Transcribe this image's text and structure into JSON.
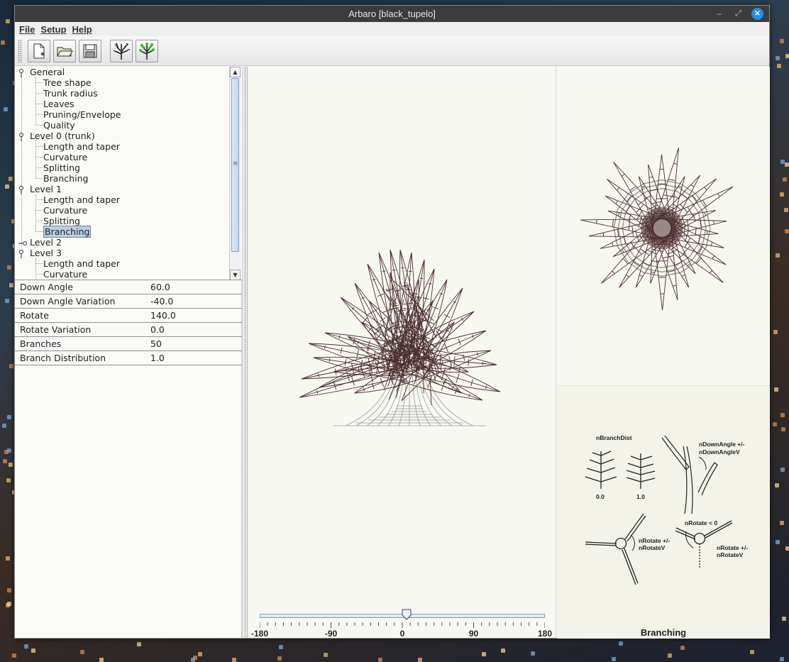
{
  "window": {
    "title": "Arbaro [black_tupelo]"
  },
  "menu": {
    "file": "File",
    "setup": "Setup",
    "help": "Help"
  },
  "toolbar": {
    "buttons": [
      "new-file-icon",
      "open-folder-icon",
      "save-disk-icon",
      "render-tree-icon",
      "render-leafy-tree-icon"
    ]
  },
  "tree": {
    "general": "General",
    "tree_shape": "Tree shape",
    "trunk_radius": "Trunk radius",
    "leaves": "Leaves",
    "pruning": "Pruning/Envelope",
    "quality": "Quality",
    "level0": "Level 0 (trunk)",
    "l0_length": "Length and taper",
    "l0_curvature": "Curvature",
    "l0_splitting": "Splitting",
    "l0_branching": "Branching",
    "level1": "Level 1",
    "l1_length": "Length and taper",
    "l1_curvature": "Curvature",
    "l1_splitting": "Splitting",
    "l1_branching": "Branching",
    "level2": "Level 2",
    "level3": "Level 3",
    "l3_length": "Length and taper",
    "l3_curvature": "Curvature",
    "selected": "Level 1 / Branching"
  },
  "properties": [
    {
      "name": "Down Angle",
      "value": "60.0"
    },
    {
      "name": "Down Angle Variation",
      "value": "-40.0"
    },
    {
      "name": "Rotate",
      "value": "140.0"
    },
    {
      "name": "Rotate Variation",
      "value": "0.0"
    },
    {
      "name": "Branches",
      "value": "50"
    },
    {
      "name": "Branch Distribution",
      "value": "1.0"
    }
  ],
  "rotation_slider": {
    "value": 5,
    "min": -180,
    "max": 180,
    "labels": [
      "-180",
      "-90",
      "0",
      "90",
      "180"
    ]
  },
  "diagram": {
    "caption": "Branching",
    "nBranchDist": "nBranchDist",
    "dist_zero": "0.0",
    "dist_one": "1.0",
    "downangle_line1": "nDownAngle +/-",
    "downangle_line2": "nDownAngleV",
    "rotate_line1": "nRotate +/-",
    "rotate_line2": "nRotateV",
    "rotate_neg": "nRotate < 0",
    "rotate2_line1": "nRotate +/-",
    "rotate2_line2": "nRotateV"
  },
  "colors": {
    "branch": "#4a2e2e",
    "trunk": "#9a9a9a",
    "selection": "#b8cfe5",
    "titlebar": "#3c3c3c",
    "close": "#2a8ee0"
  }
}
